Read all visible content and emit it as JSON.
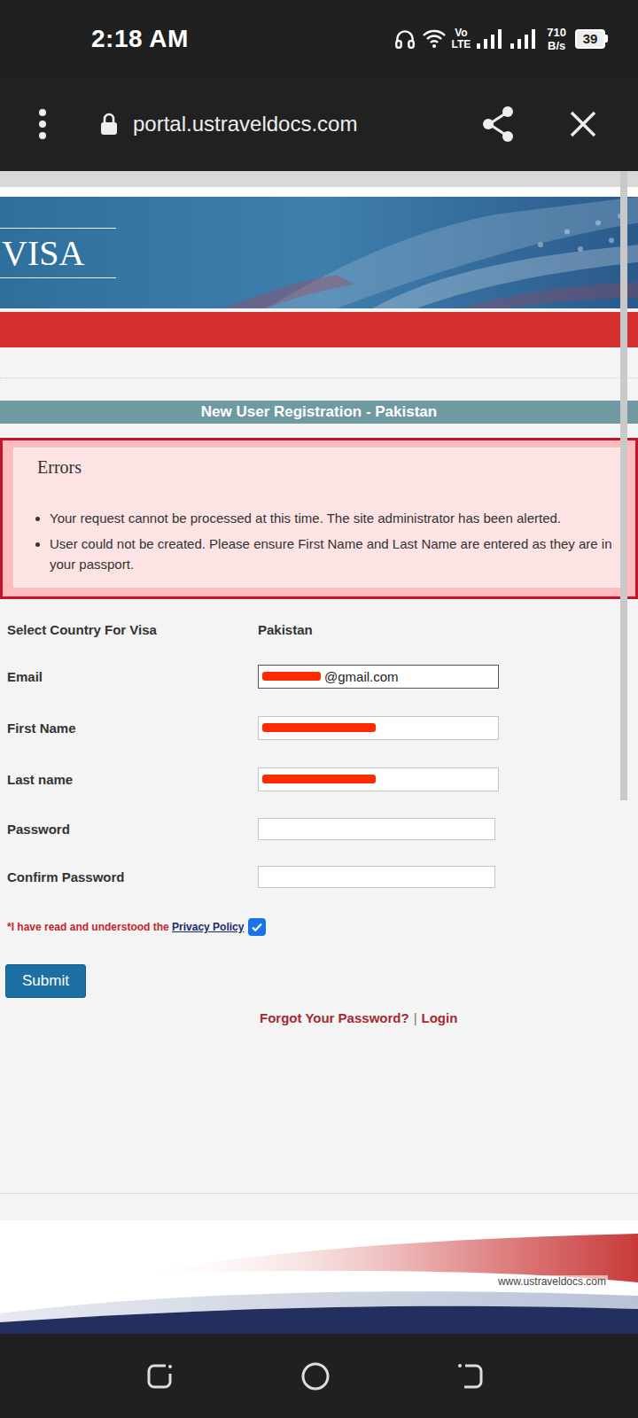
{
  "status_bar": {
    "time": "2:18 AM",
    "network_top": "Vo",
    "network_bottom": "LTE",
    "speed_value": "710",
    "speed_unit": "B/s",
    "battery": "39"
  },
  "browser": {
    "url": "portal.ustraveldocs.com"
  },
  "banner": {
    "title": "VISA"
  },
  "form": {
    "heading": "New User Registration - Pakistan",
    "errors": {
      "title": "Errors",
      "items": [
        "Your request cannot be processed at this time. The site administrator has been alerted.",
        "User could not be created. Please ensure First Name and Last Name are entered as they are in your passport."
      ]
    },
    "fields": [
      {
        "label": "Select Country For Visa",
        "kind": "static",
        "value": "Pakistan",
        "redacted": false,
        "focused": false
      },
      {
        "label": "Email",
        "kind": "text",
        "value": "@gmail.com",
        "redacted": true,
        "focused": true
      },
      {
        "label": "First Name",
        "kind": "text",
        "value": "",
        "redacted": true,
        "focused": false
      },
      {
        "label": "Last name",
        "kind": "text",
        "value": "",
        "redacted": true,
        "focused": false
      },
      {
        "label": "Password",
        "kind": "password",
        "value": "",
        "redacted": false,
        "focused": false
      },
      {
        "label": "Confirm Password",
        "kind": "password",
        "value": "",
        "redacted": false,
        "focused": false
      }
    ],
    "privacy": {
      "text": "*I have read and understood the ",
      "link": "Privacy Policy",
      "checked": true
    },
    "submit": "Submit",
    "links": [
      "Forgot Your Password?",
      "Login"
    ],
    "separator": "|"
  },
  "footer": {
    "url": "www.ustraveldocs.com"
  }
}
